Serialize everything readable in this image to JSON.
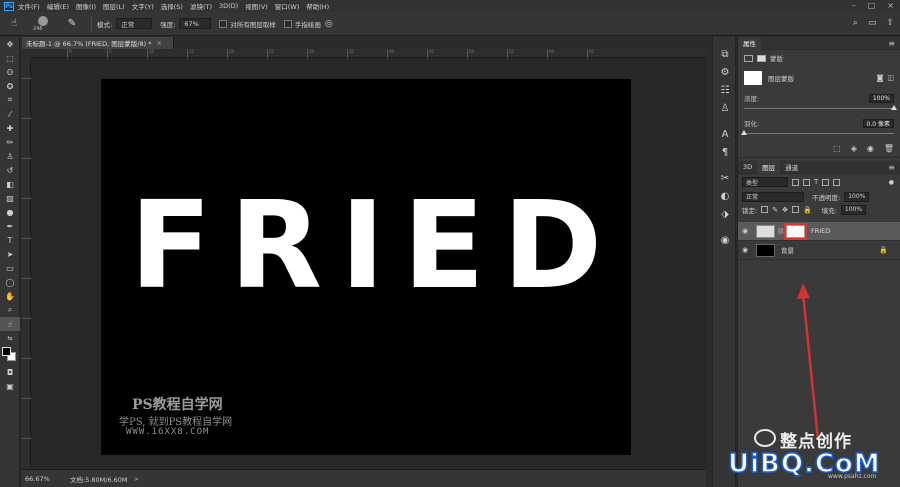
{
  "menubar": {
    "logo": "Ps",
    "items": [
      "文件(F)",
      "编辑(E)",
      "图像(I)",
      "图层(L)",
      "文字(Y)",
      "选择(S)",
      "滤镜(T)",
      "3D(D)",
      "视图(V)",
      "窗口(W)",
      "帮助(H)"
    ],
    "controls": [
      "–",
      "□",
      "×"
    ]
  },
  "options": {
    "brush_size": "246",
    "mode_label": "模式:",
    "mode_value": "正常",
    "strength_label": "强度:",
    "strength_value": "67%",
    "sample_all_label": "对所有图层取样",
    "finger_paint_label": "手指绘画"
  },
  "document": {
    "tab_title": "未标题-1 @ 66.7% (FRIED, 图层蒙版/8) *",
    "tab_close": "×",
    "canvas_text": "FRIED",
    "ruler_marks": [
      "0",
      "5",
      "10",
      "15",
      "20",
      "25",
      "30",
      "35",
      "40",
      "45",
      "50",
      "55",
      "60",
      "65"
    ]
  },
  "watermark": {
    "line1": "PS教程自学网",
    "line2": "学PS, 就到PS教程自学网",
    "line3": "WWW.16XX8.COM"
  },
  "status": {
    "zoom": "66.67%",
    "doc_info": "文档:5.80M/6.60M",
    "arrow": ">"
  },
  "properties": {
    "tab": "属性",
    "mask_label": "蒙版",
    "layer_mask_label": "图层蒙版",
    "density_label": "浓度:",
    "density_value": "100%",
    "density_fraction": 1.0,
    "feather_label": "羽化:",
    "feather_value": "0.0 像素",
    "feather_fraction": 0.0
  },
  "layers_panel": {
    "tabs": [
      "3D",
      "图层",
      "通道"
    ],
    "active_tab": "图层",
    "filter_label": "类型",
    "blend_mode": "正常",
    "opacity_label": "不透明度:",
    "opacity_value": "100%",
    "lock_label": "锁定:",
    "fill_label": "填充:",
    "fill_value": "100%",
    "layers": [
      {
        "name": "FRIED",
        "selected": true
      },
      {
        "name": "背景",
        "selected": false
      }
    ]
  },
  "overlay_watermark": {
    "brand": "整点创作",
    "site": "UiBQ.CoM",
    "url": "www.psahz.com"
  },
  "colors": {
    "accent_red": "#d33333",
    "ps_blue": "#31a8ff"
  }
}
